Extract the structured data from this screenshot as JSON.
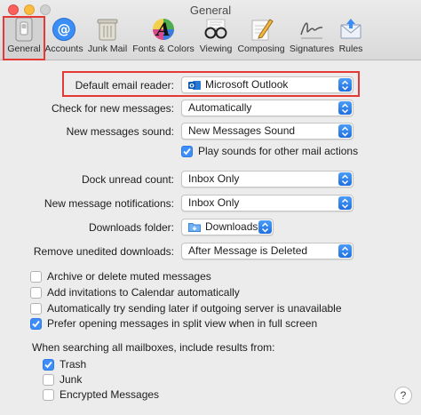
{
  "window": {
    "title": "General"
  },
  "toolbar": {
    "items": [
      {
        "label": "General",
        "icon": "general-switch-icon",
        "selected": true
      },
      {
        "label": "Accounts",
        "icon": "at-icon"
      },
      {
        "label": "Junk Mail",
        "icon": "trash-bin-icon"
      },
      {
        "label": "Fonts & Colors",
        "icon": "fonts-colors-icon"
      },
      {
        "label": "Viewing",
        "icon": "glasses-icon"
      },
      {
        "label": "Composing",
        "icon": "pencil-paper-icon"
      },
      {
        "label": "Signatures",
        "icon": "signature-icon"
      },
      {
        "label": "Rules",
        "icon": "rules-envelope-icon"
      }
    ]
  },
  "settings": {
    "default_email_reader": {
      "label": "Default email reader:",
      "value": "Microsoft Outlook"
    },
    "check_new_messages": {
      "label": "Check for new messages:",
      "value": "Automatically"
    },
    "new_messages_sound": {
      "label": "New messages sound:",
      "value": "New Messages Sound"
    },
    "play_sounds": {
      "label": "Play sounds for other mail actions",
      "checked": true
    },
    "dock_unread_count": {
      "label": "Dock unread count:",
      "value": "Inbox Only"
    },
    "new_message_notifications": {
      "label": "New message notifications:",
      "value": "Inbox Only"
    },
    "downloads_folder": {
      "label": "Downloads folder:",
      "value": "Downloads"
    },
    "remove_unedited_downloads": {
      "label": "Remove unedited downloads:",
      "value": "After Message is Deleted"
    }
  },
  "options": [
    {
      "label": "Archive or delete muted messages",
      "checked": false
    },
    {
      "label": "Add invitations to Calendar automatically",
      "checked": false
    },
    {
      "label": "Automatically try sending later if outgoing server is unavailable",
      "checked": false
    },
    {
      "label": "Prefer opening messages in split view when in full screen",
      "checked": true
    }
  ],
  "search": {
    "label": "When searching all mailboxes, include results from:",
    "items": [
      {
        "label": "Trash",
        "checked": true
      },
      {
        "label": "Junk",
        "checked": false
      },
      {
        "label": "Encrypted Messages",
        "checked": false
      }
    ]
  },
  "help": {
    "label": "?"
  },
  "colors": {
    "accent": "#3e8ef7",
    "highlight": "#e53935"
  }
}
